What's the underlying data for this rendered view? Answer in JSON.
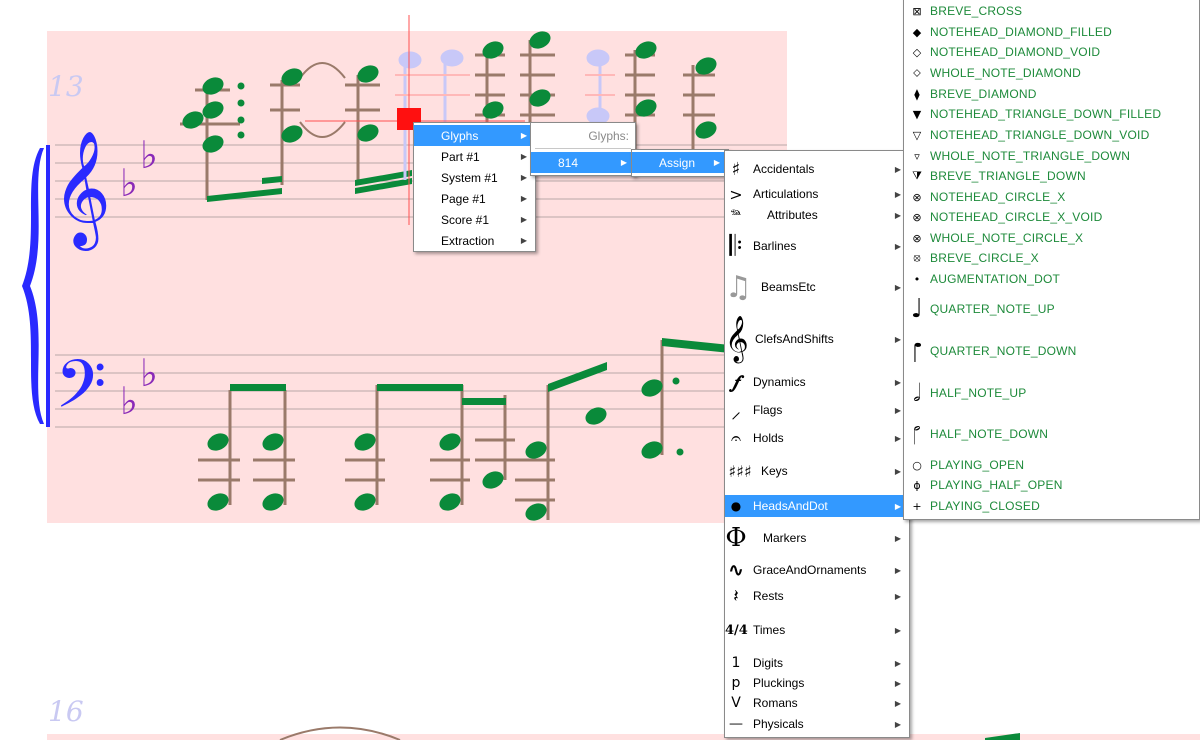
{
  "score": {
    "measure_numbers": [
      "13",
      "16"
    ],
    "colors": {
      "background": "#ffe0e0",
      "notehead": "#0a8a3a",
      "staff": "#9a7a6a",
      "clef": "#2a2aff",
      "keysig": "#8a2ab8"
    }
  },
  "menu_main": {
    "items": [
      {
        "label": "Glyphs",
        "selected": true
      },
      {
        "label": "Part #1"
      },
      {
        "label": "System #1"
      },
      {
        "label": "Page #1"
      },
      {
        "label": "Score #1"
      },
      {
        "label": "Extraction"
      }
    ]
  },
  "menu_glyphs": {
    "header": "Glyphs:",
    "items": [
      {
        "label": "814",
        "selected": true
      }
    ]
  },
  "menu_814": {
    "items": [
      {
        "label": "Assign",
        "selected": true
      }
    ]
  },
  "menu_assign": {
    "items": [
      {
        "label": "Accidentals",
        "icon": "sharp-icon",
        "glyph": "♯"
      },
      {
        "label": "Articulations",
        "icon": "accent-icon",
        "glyph": ">"
      },
      {
        "label": "Attributes",
        "icon": "pedal-icon",
        "glyph": "𝆮"
      },
      {
        "label": "Barlines",
        "icon": "barline-icon",
        "glyph": "𝄆"
      },
      {
        "label": "BeamsEtc",
        "icon": "beam-icon",
        "glyph": "♫"
      },
      {
        "label": "ClefsAndShifts",
        "icon": "treble-clef-icon",
        "glyph": "𝄞"
      },
      {
        "label": "Dynamics",
        "icon": "forte-icon",
        "glyph": "𝆑"
      },
      {
        "label": "Flags",
        "icon": "flag-icon",
        "glyph": "⸝"
      },
      {
        "label": "Holds",
        "icon": "fermata-icon",
        "glyph": "𝄐"
      },
      {
        "label": "Keys",
        "icon": "key-signature-icon",
        "glyph": "♯♯♯"
      },
      {
        "label": "HeadsAndDot",
        "icon": "notehead-icon",
        "glyph": "●",
        "selected": true
      },
      {
        "label": "Markers",
        "icon": "coda-icon",
        "glyph": "Φ"
      },
      {
        "label": "GraceAndOrnaments",
        "icon": "trill-icon",
        "glyph": "∿"
      },
      {
        "label": "Rests",
        "icon": "rest-icon",
        "glyph": "𝄽"
      },
      {
        "label": "Times",
        "icon": "time-signature-icon",
        "glyph": "4/4"
      },
      {
        "label": "Digits",
        "icon": "digit-icon",
        "glyph": "1"
      },
      {
        "label": "Pluckings",
        "icon": "plucking-icon",
        "glyph": "p"
      },
      {
        "label": "Romans",
        "icon": "roman-icon",
        "glyph": "V"
      },
      {
        "label": "Physicals",
        "icon": "line-icon",
        "glyph": "—"
      }
    ]
  },
  "menu_heads": {
    "items": [
      {
        "label": "BREVE_CROSS",
        "icon": "breve-cross-icon",
        "glyph": "⊠"
      },
      {
        "label": "NOTEHEAD_DIAMOND_FILLED",
        "icon": "diamond-filled-icon",
        "glyph": "◆"
      },
      {
        "label": "NOTEHEAD_DIAMOND_VOID",
        "icon": "diamond-void-icon",
        "glyph": "◇"
      },
      {
        "label": "WHOLE_NOTE_DIAMOND",
        "icon": "whole-diamond-icon",
        "glyph": "⬦"
      },
      {
        "label": "BREVE_DIAMOND",
        "icon": "breve-diamond-icon",
        "glyph": "⧫"
      },
      {
        "label": "NOTEHEAD_TRIANGLE_DOWN_FILLED",
        "icon": "triangle-down-filled-icon",
        "glyph": "▼"
      },
      {
        "label": "NOTEHEAD_TRIANGLE_DOWN_VOID",
        "icon": "triangle-down-void-icon",
        "glyph": "▽"
      },
      {
        "label": "WHOLE_NOTE_TRIANGLE_DOWN",
        "icon": "whole-triangle-down-icon",
        "glyph": "▿"
      },
      {
        "label": "BREVE_TRIANGLE_DOWN",
        "icon": "breve-triangle-down-icon",
        "glyph": "⧩"
      },
      {
        "label": "NOTEHEAD_CIRCLE_X",
        "icon": "circle-x-icon",
        "glyph": "⊗"
      },
      {
        "label": "NOTEHEAD_CIRCLE_X_VOID",
        "icon": "circle-x-void-icon",
        "glyph": "⊗"
      },
      {
        "label": "WHOLE_NOTE_CIRCLE_X",
        "icon": "whole-circle-x-icon",
        "glyph": "⊗"
      },
      {
        "label": "BREVE_CIRCLE_X",
        "icon": "breve-circle-x-icon",
        "glyph": "⦻"
      },
      {
        "label": "AUGMENTATION_DOT",
        "icon": "augmentation-dot-icon",
        "glyph": "•"
      },
      {
        "label": "QUARTER_NOTE_UP",
        "icon": "quarter-note-up-icon",
        "glyph": "♩"
      },
      {
        "label": "QUARTER_NOTE_DOWN",
        "icon": "quarter-note-down-icon",
        "glyph": "♩"
      },
      {
        "label": "HALF_NOTE_UP",
        "icon": "half-note-up-icon",
        "glyph": "𝅗𝅥"
      },
      {
        "label": "HALF_NOTE_DOWN",
        "icon": "half-note-down-icon",
        "glyph": "𝅗𝅥"
      },
      {
        "label": "PLAYING_OPEN",
        "icon": "playing-open-icon",
        "glyph": "○"
      },
      {
        "label": "PLAYING_HALF_OPEN",
        "icon": "playing-half-open-icon",
        "glyph": "ɸ"
      },
      {
        "label": "PLAYING_CLOSED",
        "icon": "playing-closed-icon",
        "glyph": "+"
      }
    ]
  }
}
